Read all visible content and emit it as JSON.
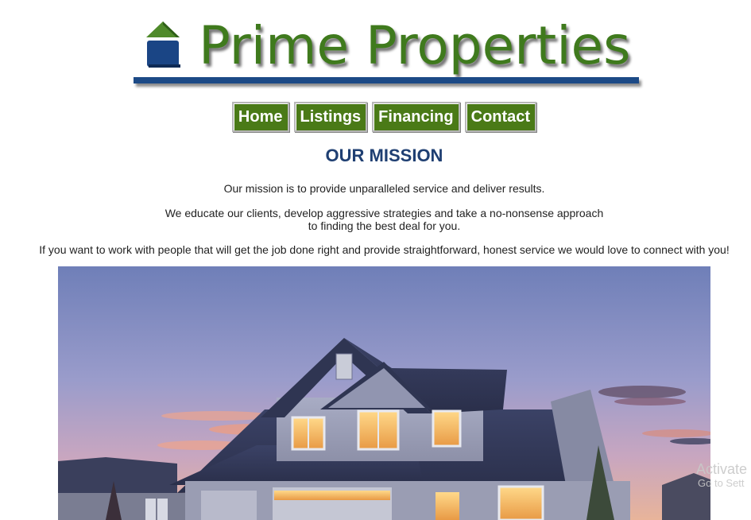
{
  "brand": {
    "title": "Prime Properties",
    "primary_green": "#3f7a1d",
    "accent_blue": "#1c4a86"
  },
  "nav": {
    "items": [
      {
        "label": "Home"
      },
      {
        "label": "Listings"
      },
      {
        "label": "Financing"
      },
      {
        "label": "Contact"
      }
    ]
  },
  "mission": {
    "title": "OUR MISSION",
    "p1": "Our mission is to provide unparalleled service and deliver results.",
    "p2_line1": "We educate our clients, develop aggressive strategies and take a no-nonsense approach",
    "p2_line2": "to finding the best deal for you.",
    "p3": "If you want to work with people that will get the job done right and provide straightforward, honest service we would love to connect with you!"
  },
  "hero": {
    "icon": "house-photo-icon"
  },
  "watermark": {
    "line1": "Activate",
    "line2": "Go to Sett"
  }
}
